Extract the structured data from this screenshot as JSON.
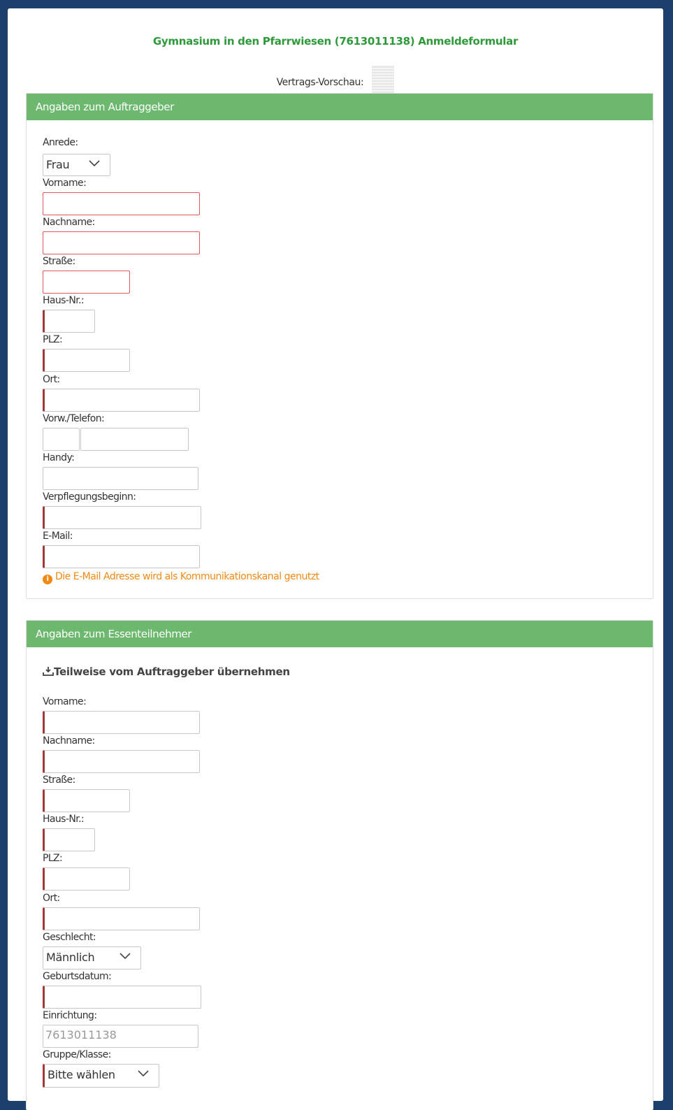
{
  "header": {
    "title": "Gymnasium in den Pfarrwiesen (7613011138) Anmeldeformular",
    "preview_label": "Vertrags-Vorschau:"
  },
  "client": {
    "heading": "Angaben zum Auftraggeber",
    "anrede_label": "Anrede:",
    "anrede_value": "Frau",
    "vorname_label": "Vorname:",
    "nachname_label": "Nachname:",
    "strasse_label": "Straße:",
    "hausnr_label": "Haus-Nr.:",
    "plz_label": "PLZ:",
    "ort_label": "Ort:",
    "telefon_label": "Vorw./Telefon:",
    "handy_label": "Handy:",
    "verpflegung_label": "Verpflegungsbeginn:",
    "email_label": "E-Mail:",
    "email_info": "Die E-Mail Adresse wird als Kommunikationskanal genutzt"
  },
  "participant": {
    "heading": "Angaben zum Essenteilnehmer",
    "copy_link": "Teilweise vom Auftraggeber übernehmen",
    "vorname_label": "Vorname:",
    "nachname_label": "Nachname:",
    "strasse_label": "Straße:",
    "hausnr_label": "Haus-Nr.:",
    "plz_label": "PLZ:",
    "ort_label": "Ort:",
    "geschlecht_label": "Geschlecht:",
    "geschlecht_value": "Männlich",
    "geburtsdatum_label": "Geburtsdatum:",
    "einrichtung_label": "Einrichtung:",
    "einrichtung_value": "7613011138",
    "gruppe_label": "Gruppe/Klasse:",
    "gruppe_value": "Bitte wählen"
  },
  "colors": {
    "background": "#1c3f6e",
    "panel_header": "#6cb86e",
    "title_green": "#2e9a3a",
    "required_marker": "#a23a3a",
    "error_border": "#e05a5a",
    "info_orange": "#f08a14"
  },
  "icons": {
    "info": "info-circle-icon",
    "copy": "download-tray-icon",
    "dropdown": "chevron-down-icon",
    "preview": "document-thumbnail-icon"
  }
}
